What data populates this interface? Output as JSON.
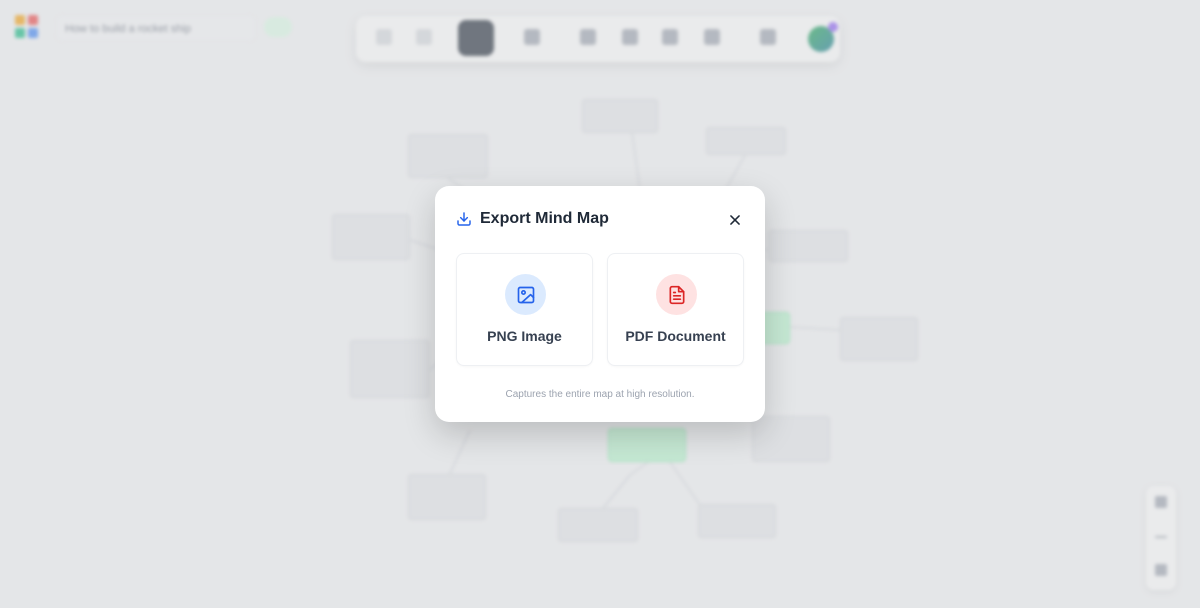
{
  "app": {
    "document_title": "How to build a rocket ship"
  },
  "modal": {
    "title": "Export Mind Map",
    "options": [
      {
        "label": "PNG Image",
        "icon": "image-icon",
        "color": "#2563eb"
      },
      {
        "label": "PDF Document",
        "icon": "file-text-icon",
        "color": "#dc2626"
      }
    ],
    "footnote": "Captures the entire map at high resolution."
  },
  "colors": {
    "png_accent": "#2563eb",
    "pdf_accent": "#dc2626",
    "green_node": "#bbf7d0"
  }
}
